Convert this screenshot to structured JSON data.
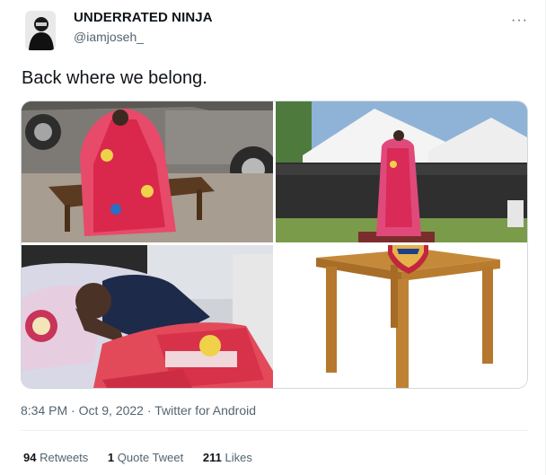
{
  "author": {
    "display_name": "UNDERRATED NINJA",
    "handle": "@iamjoseh_"
  },
  "tweet": {
    "text": "Back where we belong.",
    "time": "8:34 PM",
    "date": "Oct 9, 2022",
    "source": "Twitter for Android",
    "more_icon": "···"
  },
  "stats": {
    "retweets_count": "94",
    "retweets_label": "Retweets",
    "quotes_count": "1",
    "quotes_label": "Quote Tweet",
    "likes_count": "211",
    "likes_label": "Likes"
  },
  "media": [
    {
      "name": "man-on-table-by-car"
    },
    {
      "name": "man-standing-on-podium"
    },
    {
      "name": "man-sleeping-in-bed"
    },
    {
      "name": "wooden-table-with-crest"
    }
  ],
  "colors": {
    "text": "#0f1419",
    "muted": "#536471",
    "border": "#cfd9de",
    "arsenal_red": "#db2a4c"
  }
}
